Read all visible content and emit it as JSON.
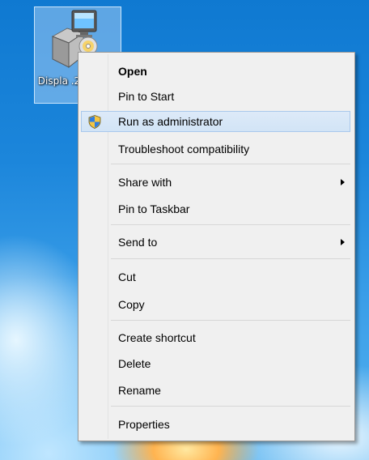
{
  "desktop": {
    "icon_label": "Displa .2",
    "icon_name": "installer-file-icon"
  },
  "context_menu": {
    "items": [
      {
        "label": "Open",
        "bold": true
      },
      {
        "label": "Pin to Start"
      },
      {
        "label": "Run as administrator",
        "icon": "uac-shield-icon",
        "highlighted": true
      },
      {
        "label": "Troubleshoot compatibility"
      },
      {
        "label": "Share with",
        "submenu": true
      },
      {
        "label": "Pin to Taskbar"
      },
      {
        "label": "Send to",
        "submenu": true
      },
      {
        "label": "Cut"
      },
      {
        "label": "Copy"
      },
      {
        "label": "Create shortcut"
      },
      {
        "label": "Delete"
      },
      {
        "label": "Rename"
      },
      {
        "label": "Properties"
      }
    ]
  },
  "colors": {
    "desktop_blue": "#1c86db",
    "menu_background": "#f0f0f0",
    "highlight_fill": "#d7e6f7",
    "highlight_border": "#a9c8ec"
  }
}
